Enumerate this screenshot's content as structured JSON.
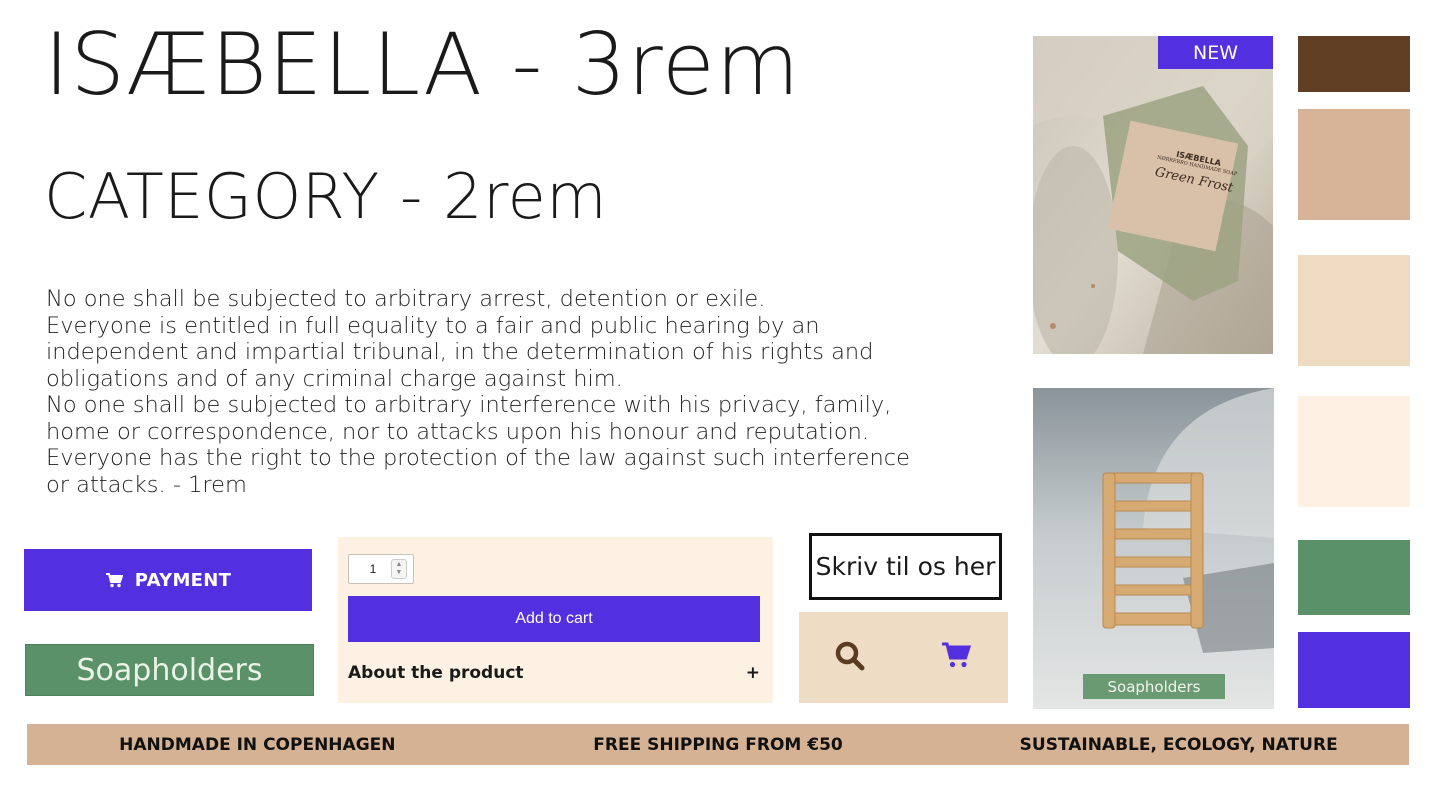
{
  "headings": {
    "h1": "ISÆBELLA - 3rem",
    "h2": "CATEGORY - 2rem"
  },
  "body": {
    "paragraphs": [
      "No one shall be subjected to arbitrary arrest, detention or exile.",
      "Everyone is entitled in full equality to a fair and public hearing by an independent and impartial tribunal, in the determination of his rights and obligations and of any criminal charge against him.",
      "No one shall be subjected to arbitrary interference with his privacy, family, home or correspondence, nor to attacks upon his honour and reputation. Everyone has the right to the protection of the law against such interference or attacks. - 1rem"
    ]
  },
  "buttons": {
    "payment": "PAYMENT",
    "soapholders": "Soapholders",
    "contact": "Skriv til os her"
  },
  "cart": {
    "quantity": "1",
    "add_to_cart": "Add to cart",
    "about_label": "About the product",
    "about_toggle": "+"
  },
  "photos": {
    "badge": "NEW",
    "label": "Soapholders",
    "soap_brand": "ISÆBELLA",
    "soap_sub": "NØRREBRO HANDMADE SOAP",
    "soap_name": "Green Frost"
  },
  "palette": [
    "#613f24",
    "#d7b497",
    "#eedbc2",
    "#fdf1e4",
    "#5a9168",
    "#5230e0"
  ],
  "icons": {
    "cart": "cart-icon",
    "search": "search-icon"
  },
  "banner": {
    "items": [
      "HANDMADE IN COPENHAGEN",
      "FREE SHIPPING FROM €50",
      "SUSTAINABLE, ECOLOGY, NATURE"
    ]
  }
}
